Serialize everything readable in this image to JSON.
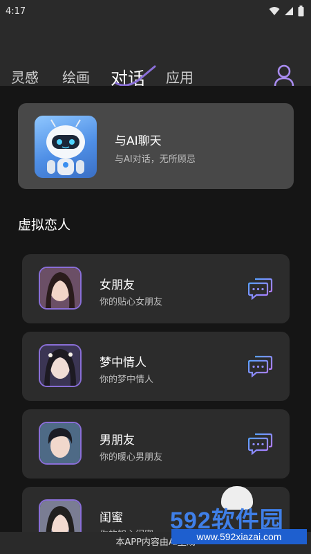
{
  "status": {
    "time": "4:17"
  },
  "tabs": [
    {
      "label": "灵感"
    },
    {
      "label": "绘画"
    },
    {
      "label": "对话",
      "active": true
    },
    {
      "label": "应用"
    }
  ],
  "colors": {
    "accent": "#8a6fd8",
    "profile_icon": "#a98cf0",
    "card_bg": "#484848",
    "item_bg": "#2c2c2c"
  },
  "ai_card": {
    "title": "与AI聊天",
    "subtitle": "与AI对话，无所顾忌"
  },
  "section": {
    "title": "虚拟恋人"
  },
  "contacts": [
    {
      "name": "女朋友",
      "desc": "你的贴心女朋友"
    },
    {
      "name": "梦中情人",
      "desc": "你的梦中情人"
    },
    {
      "name": "男朋友",
      "desc": "你的暖心男朋友"
    },
    {
      "name": "闺蜜",
      "desc": "你的知心闺蜜"
    }
  ],
  "footer": {
    "text": "本APP内容由AI生成"
  },
  "watermark": {
    "logo": "592软件园",
    "url": "www.592xiazai.com"
  }
}
